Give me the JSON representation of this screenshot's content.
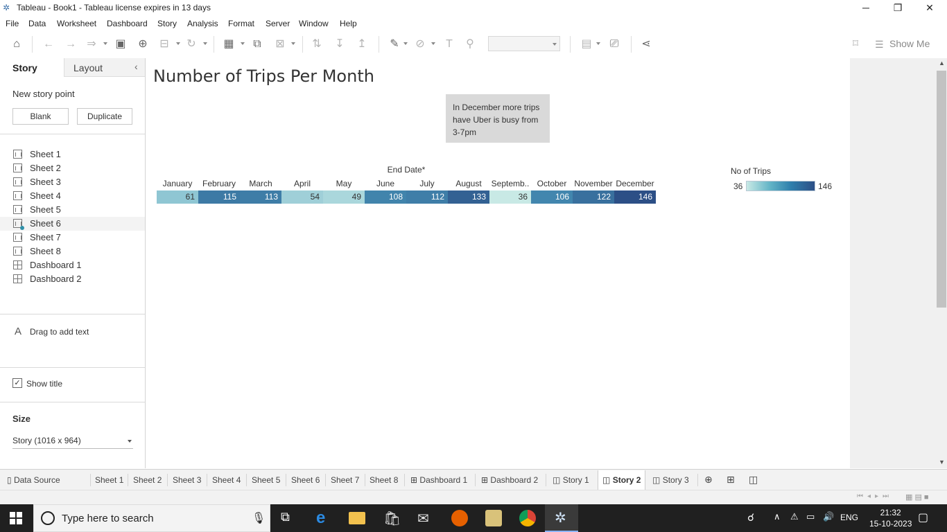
{
  "window": {
    "title": "Tableau - Book1 - Tableau license expires in 13 days"
  },
  "menu": [
    "File",
    "Data",
    "Worksheet",
    "Dashboard",
    "Story",
    "Analysis",
    "Format",
    "Server",
    "Window",
    "Help"
  ],
  "toolbar": {
    "show_me": "Show Me"
  },
  "left_pane": {
    "tabs": {
      "story": "Story",
      "layout": "Layout"
    },
    "new_story_point": "New story point",
    "blank_button": "Blank",
    "duplicate_button": "Duplicate",
    "sheets": [
      {
        "label": "Sheet 1",
        "type": "sheet"
      },
      {
        "label": "Sheet 2",
        "type": "sheet"
      },
      {
        "label": "Sheet 3",
        "type": "sheet"
      },
      {
        "label": "Sheet 4",
        "type": "sheet"
      },
      {
        "label": "Sheet 5",
        "type": "sheet"
      },
      {
        "label": "Sheet 6",
        "type": "sheet"
      },
      {
        "label": "Sheet 7",
        "type": "sheet"
      },
      {
        "label": "Sheet 8",
        "type": "sheet"
      },
      {
        "label": "Dashboard 1",
        "type": "dashboard"
      },
      {
        "label": "Dashboard 2",
        "type": "dashboard"
      }
    ],
    "drag_text": "Drag to add text",
    "show_title": "Show title",
    "size_heading": "Size",
    "size_value": "Story (1016 x 964)"
  },
  "story": {
    "title": "Number of Trips Per Month",
    "annotation": "In December more trips have Uber is busy from 3-7pm"
  },
  "chart_data": {
    "type": "heatmap",
    "title": "",
    "xlabel": "End Date*",
    "categories": [
      "January",
      "February",
      "March",
      "April",
      "May",
      "June",
      "July",
      "August",
      "Septemb..",
      "October",
      "November",
      "December"
    ],
    "values": [
      61,
      115,
      113,
      54,
      49,
      108,
      112,
      133,
      36,
      106,
      122,
      146
    ],
    "legend": {
      "title": "No of Trips",
      "min": 36,
      "max": 146
    },
    "colors": {
      "low": "#c8e9e5",
      "mid": "#4a9bbd",
      "high": "#2c4f86"
    }
  },
  "bottom_tabs": [
    {
      "label": "Data Source"
    },
    {
      "label": "Sheet 1"
    },
    {
      "label": "Sheet 2"
    },
    {
      "label": "Sheet 3"
    },
    {
      "label": "Sheet 4"
    },
    {
      "label": "Sheet 5"
    },
    {
      "label": "Sheet 6"
    },
    {
      "label": "Sheet 7"
    },
    {
      "label": "Sheet 8"
    },
    {
      "label": "Dashboard 1"
    },
    {
      "label": "Dashboard 2"
    },
    {
      "label": "Story 1"
    },
    {
      "label": "Story 2"
    },
    {
      "label": "Story 3"
    }
  ],
  "taskbar": {
    "search_placeholder": "Type here to search",
    "language": "ENG",
    "time": "21:32",
    "date": "15-10-2023"
  }
}
